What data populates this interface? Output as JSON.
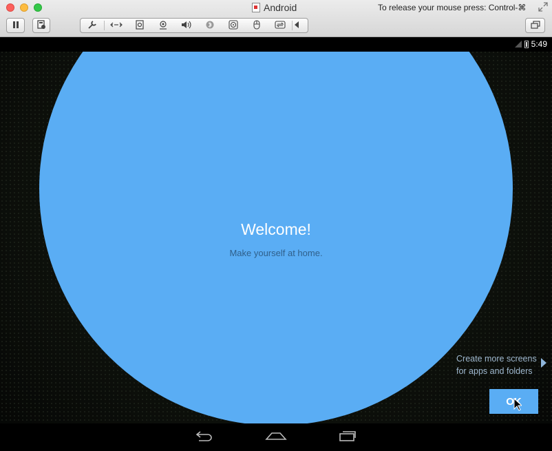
{
  "window": {
    "title": "Android",
    "release_hint": "To release your mouse press: Control-⌘"
  },
  "toolbar": {
    "pause_icon": "pause-icon",
    "snapshot_icon": "snapshot-icon",
    "tools": [
      "wrench-icon",
      "network-icon",
      "disk-icon",
      "webcam-icon",
      "sound-icon",
      "bluetooth-icon",
      "cd-icon",
      "usb-icon",
      "sharing-icon"
    ],
    "collapse_icon": "collapse-arrow-icon",
    "restore_icon": "restore-windows-icon"
  },
  "statusbar": {
    "time": "5:49"
  },
  "welcome": {
    "title": "Welcome!",
    "subtitle": "Make yourself at home.",
    "accent_color": "#5aadf4"
  },
  "hint": {
    "line1": "Create more screens",
    "line2": "for apps and folders"
  },
  "ok_button": {
    "label": "OK"
  },
  "navbar": {
    "back_icon": "back-icon",
    "home_icon": "home-icon",
    "recents_icon": "recents-icon"
  }
}
